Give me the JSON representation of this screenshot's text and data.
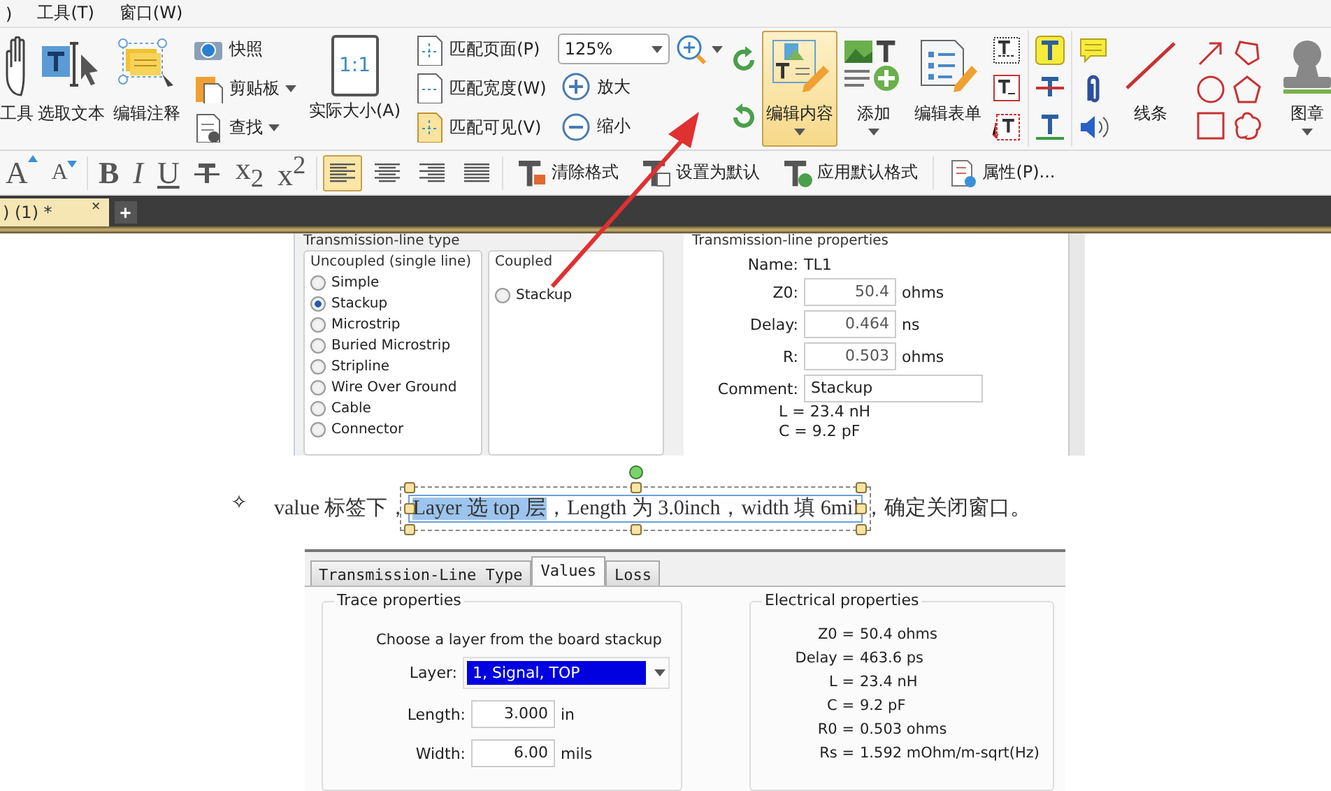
{
  "menu": [
    {
      "label": ")"
    },
    {
      "label": "工具(T)"
    },
    {
      "label": "窗口(W)"
    }
  ],
  "ribbon": [
    {
      "kind": "large",
      "label": "工具",
      "selected": false,
      "dropdown": false
    },
    {
      "kind": "large",
      "label": "选取文本",
      "selected": false,
      "dropdown": false
    },
    {
      "kind": "large",
      "label": "编辑注释",
      "selected": false,
      "dropdown": false
    },
    {
      "kind": "stack",
      "items": [
        {
          "label": "快照",
          "dropdown": false
        },
        {
          "label": "剪贴板",
          "dropdown": true
        },
        {
          "label": "查找",
          "dropdown": true
        }
      ]
    },
    {
      "kind": "large",
      "label": "实际大小(A)",
      "icon_text": "1:1",
      "selected": false,
      "dropdown": false
    },
    {
      "kind": "stack",
      "items": [
        {
          "label": "匹配页面(P)",
          "dropdown": false
        },
        {
          "label": "匹配宽度(W)",
          "dropdown": false
        },
        {
          "label": "匹配可见(V)",
          "dropdown": false
        }
      ]
    },
    {
      "kind": "zoom",
      "value": "125%",
      "items": [
        {
          "label": "放大"
        },
        {
          "label": "缩小"
        }
      ]
    },
    {
      "kind": "large",
      "label": "编辑内容",
      "selected": true,
      "dropdown": true
    },
    {
      "kind": "large",
      "label": "添加",
      "selected": false,
      "dropdown": true
    },
    {
      "kind": "large",
      "label": "编辑表单",
      "selected": false,
      "dropdown": false
    },
    {
      "kind": "iconcolumn"
    },
    {
      "kind": "iconcolumn"
    },
    {
      "kind": "iconcolumn"
    },
    {
      "kind": "large",
      "label": "线条",
      "selected": false,
      "dropdown": false
    },
    {
      "kind": "shapes"
    },
    {
      "kind": "large",
      "label": "图章",
      "selected": false,
      "dropdown": true
    }
  ],
  "format": {
    "styles": [
      {
        "kind": "grow",
        "label": "A"
      },
      {
        "kind": "shrink",
        "label": "A"
      },
      {
        "kind": "bold",
        "label": "B"
      },
      {
        "kind": "italic",
        "label": "I"
      },
      {
        "kind": "underline",
        "label": "U"
      },
      {
        "kind": "strike"
      },
      {
        "kind": "plain",
        "label": "x$_{2}$"
      },
      {
        "kind": "plain",
        "label": "x$^{2}$"
      }
    ],
    "align": [
      {
        "selected": true
      },
      {
        "selected": false
      },
      {
        "selected": false
      },
      {
        "selected": false
      }
    ],
    "actions": [
      {
        "label": "清除格式"
      },
      {
        "label": "设置为默认"
      },
      {
        "label": "应用默认格式"
      },
      {
        "label": "属性(P)..."
      }
    ]
  },
  "doc_tabs": [
    {
      "label": ") (1) *",
      "close": "×",
      "selected": true
    }
  ],
  "new_tab": "+",
  "page": {
    "top_dialog": {
      "left_legend": "Transmission-line type",
      "right_legend": "Transmission-line properties",
      "uncoupled": {
        "legend": "Uncoupled  (single line)",
        "options": [
          {
            "label": "Simple",
            "selected": false
          },
          {
            "label": "Stackup",
            "selected": true
          },
          {
            "label": "Microstrip",
            "selected": false
          },
          {
            "label": "Buried Microstrip",
            "selected": false
          },
          {
            "label": "Stripline",
            "selected": false
          },
          {
            "label": "Wire Over Ground",
            "selected": false
          },
          {
            "label": "Cable",
            "selected": false
          },
          {
            "label": "Connector",
            "selected": false
          }
        ]
      },
      "coupled": {
        "legend": "Coupled",
        "options": [
          {
            "label": "Stackup",
            "selected": false
          }
        ]
      },
      "name": {
        "label": "Name:",
        "value": "TL1"
      },
      "fields": [
        {
          "label": "Z0:",
          "value": "50.4",
          "unit": "ohms",
          "disabled": true
        },
        {
          "label": "Delay:",
          "value": "0.464",
          "unit": "ns",
          "disabled": true
        },
        {
          "label": "R:",
          "value": "0.503",
          "unit": "ohms",
          "disabled": true
        },
        {
          "label": "Comment:",
          "value": "Stackup",
          "disabled": false
        }
      ],
      "results": [
        "L =  23.4 nH",
        "C =  9.2 pF"
      ]
    },
    "paragraph": {
      "bullet": "✧",
      "segments": [
        {
          "text": "value 标签下，",
          "selected": false,
          "framed": false
        },
        {
          "text": "Layer 选 top 层",
          "selected": true,
          "framed": true
        },
        {
          "text": "，Length 为 3.0inch，width 填 6mil",
          "selected": false,
          "framed": true
        },
        {
          "text": "，确定关闭窗口。",
          "selected": false,
          "framed": false
        }
      ]
    },
    "bottom_dialog": {
      "tabs": [
        {
          "label": "Transmission-Line Type",
          "selected": false
        },
        {
          "label": "Values",
          "selected": true
        },
        {
          "label": "Loss",
          "selected": false
        }
      ],
      "trace": {
        "legend": "Trace properties",
        "hint": "Choose a layer from the board stackup",
        "layer": {
          "label": "Layer:",
          "value": "1, Signal, TOP"
        },
        "fields": [
          {
            "label": "Length:",
            "value": "3.000",
            "unit": "in"
          },
          {
            "label": "Width:",
            "value": "6.00",
            "unit": "mils"
          }
        ]
      },
      "electrical": {
        "legend": "Electrical properties",
        "rows": [
          {
            "label": "Z0 =",
            "value": "50.4 ohms"
          },
          {
            "label": "Delay =",
            "value": "463.6 ps"
          },
          {
            "label": "L =",
            "value": "23.4 nH"
          },
          {
            "label": "C =",
            "value": "9.2 pF"
          },
          {
            "label": "R0 =",
            "value": "0.503 ohms"
          },
          {
            "label": "Rs =",
            "value": "1.592 mOhm/m-sqrt(Hz)"
          }
        ]
      }
    }
  }
}
